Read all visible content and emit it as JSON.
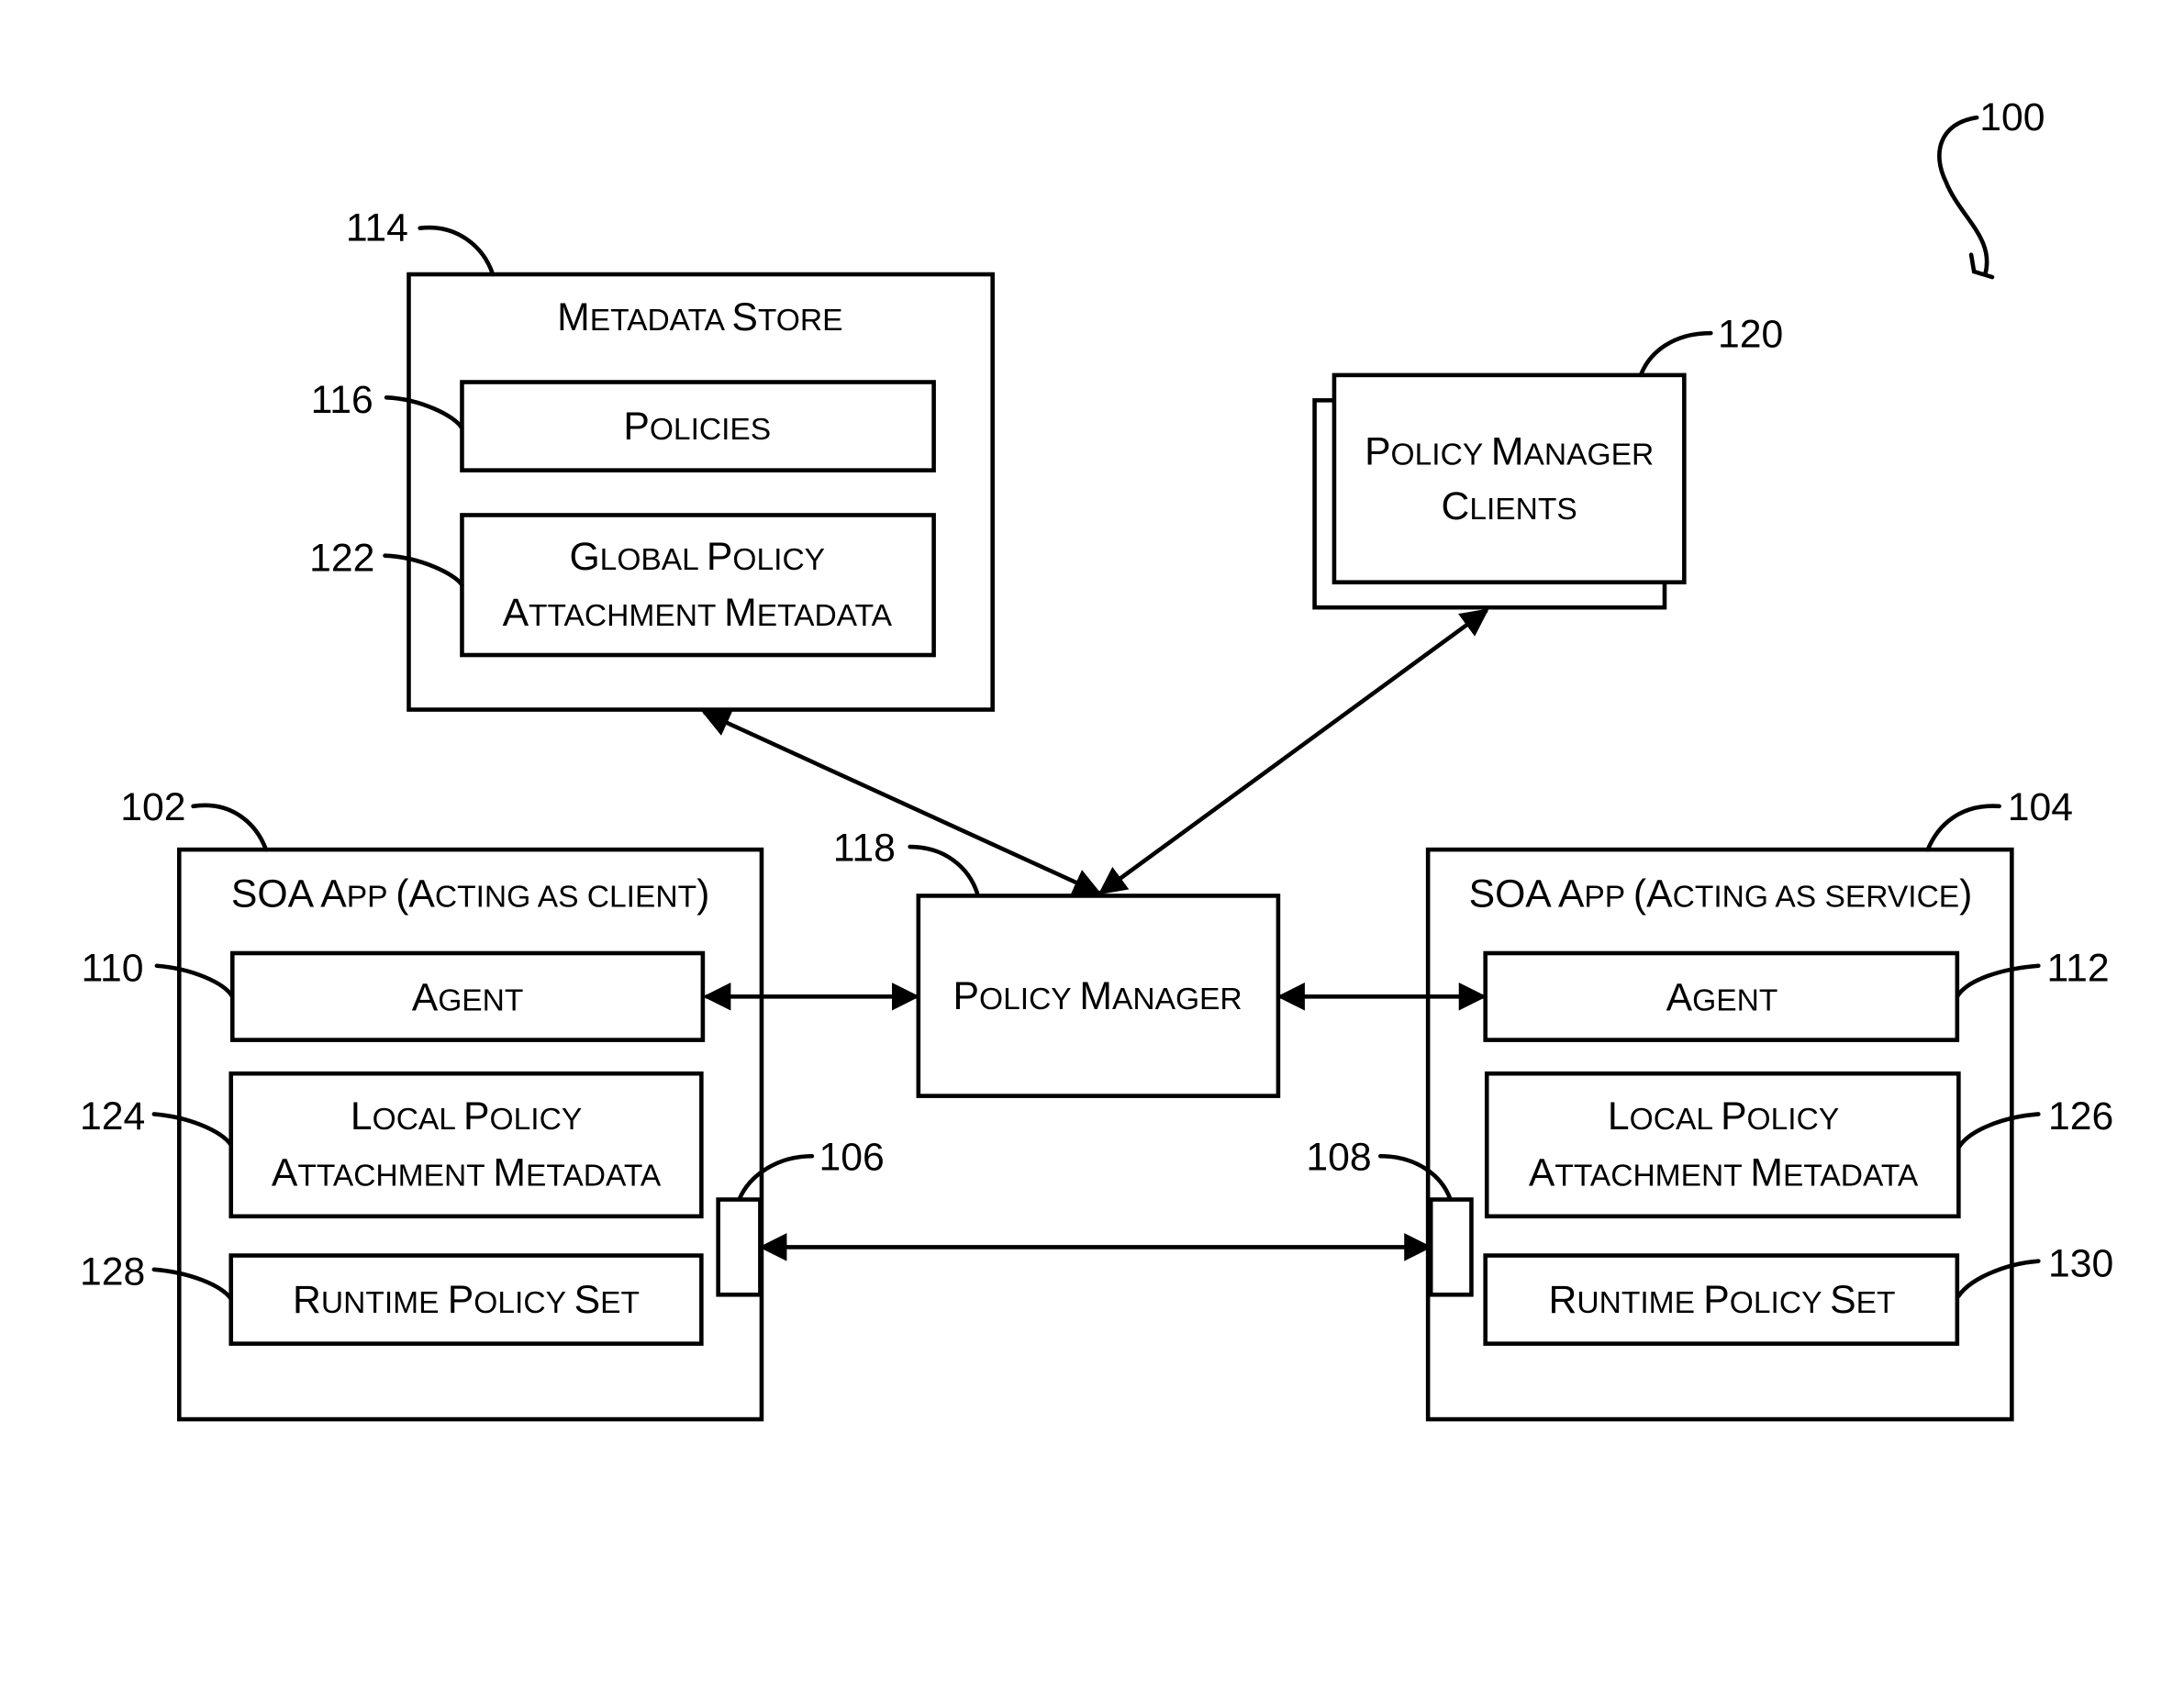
{
  "figure": {
    "ref": "100"
  },
  "metadata_store": {
    "ref": "114",
    "title": [
      "M",
      "ETADATA ",
      "S",
      "TORE"
    ],
    "policies": {
      "ref": "116",
      "label": [
        [
          "P",
          "OLICIES"
        ]
      ]
    },
    "global_policy": {
      "ref": "122",
      "label": [
        [
          "G",
          "LOBAL ",
          "P",
          "OLICY"
        ],
        [
          "A",
          "TTACHMENT ",
          "M",
          "ETADATA"
        ]
      ]
    }
  },
  "policy_manager_clients": {
    "ref": "120",
    "label": [
      [
        "P",
        "OLICY ",
        "M",
        "ANAGER"
      ],
      [
        "C",
        "LIENTS"
      ]
    ]
  },
  "policy_manager": {
    "ref": "118",
    "label": [
      [
        "P",
        "OLICY ",
        "M",
        "ANAGER"
      ]
    ]
  },
  "client_app": {
    "ref": "102",
    "title": [
      "SOA A",
      "PP ",
      "(A",
      "CTING AS CLIENT",
      ")"
    ],
    "agent": {
      "ref": "110",
      "label": [
        [
          "A",
          "GENT"
        ]
      ]
    },
    "local_policy": {
      "ref": "124",
      "label": [
        [
          "L",
          "OCAL ",
          "P",
          "OLICY"
        ],
        [
          "A",
          "TTACHMENT ",
          "M",
          "ETADATA"
        ]
      ]
    },
    "runtime_policy": {
      "ref": "128",
      "label": [
        [
          "R",
          "UNTIME ",
          "P",
          "OLICY ",
          "S",
          "ET"
        ]
      ]
    },
    "port": {
      "ref": "106"
    }
  },
  "service_app": {
    "ref": "104",
    "title": [
      "SOA A",
      "PP ",
      "(A",
      "CTING AS SERVICE",
      ")"
    ],
    "agent": {
      "ref": "112",
      "label": [
        [
          "A",
          "GENT"
        ]
      ]
    },
    "local_policy": {
      "ref": "126",
      "label": [
        [
          "L",
          "OCAL ",
          "P",
          "OLICY"
        ],
        [
          "A",
          "TTACHMENT ",
          "M",
          "ETADATA"
        ]
      ]
    },
    "runtime_policy": {
      "ref": "130",
      "label": [
        [
          "R",
          "UNTIME ",
          "P",
          "OLICY ",
          "S",
          "ET"
        ]
      ]
    },
    "port": {
      "ref": "108"
    }
  },
  "plain_text": {
    "metadata_store": "Metadata Store",
    "policies": "Policies",
    "global_policy": "Global Policy Attachment Metadata",
    "policy_manager_clients": "Policy Manager Clients",
    "policy_manager": "Policy Manager",
    "client_app": "SOA App (Acting as client)",
    "service_app": "SOA App (Acting as service)",
    "agent": "Agent",
    "local_policy": "Local Policy Attachment Metadata",
    "runtime_policy": "Runtime Policy Set"
  }
}
